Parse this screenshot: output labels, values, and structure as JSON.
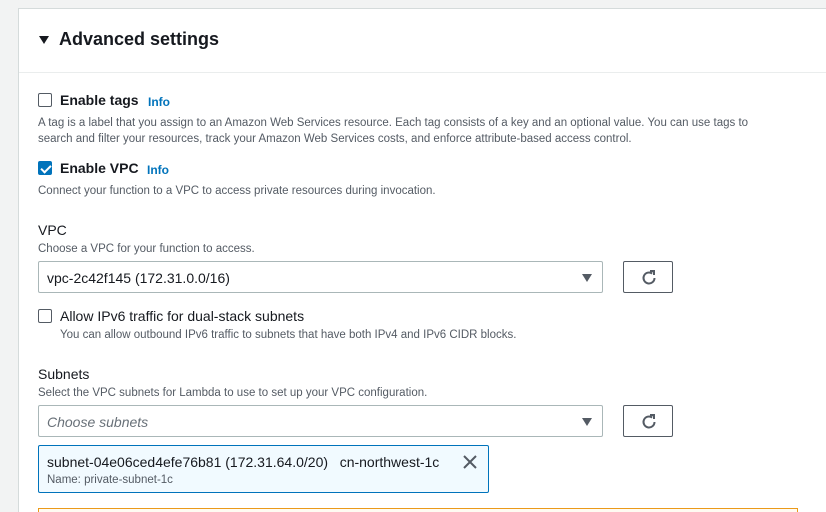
{
  "section": {
    "title": "Advanced settings"
  },
  "tags": {
    "label": "Enable tags",
    "info": "Info",
    "checked": false,
    "description_line1": "A tag is a label that you assign to an Amazon Web Services resource. Each tag consists of a key and an optional value. You can use tags to",
    "description_line2": "search and filter your resources, track your Amazon Web Services costs, and enforce attribute-based access control."
  },
  "vpc_toggle": {
    "label": "Enable VPC",
    "info": "Info",
    "checked": true,
    "description": "Connect your function to a VPC to access private resources during invocation."
  },
  "vpc": {
    "label": "VPC",
    "description": "Choose a VPC for your function to access.",
    "selected": "vpc-2c42f145 (172.31.0.0/16)"
  },
  "ipv6": {
    "label": "Allow IPv6 traffic for dual-stack subnets",
    "checked": false,
    "description": "You can allow outbound IPv6 traffic to subnets that have both IPv4 and IPv6 CIDR blocks."
  },
  "subnets": {
    "label": "Subnets",
    "description": "Select the VPC subnets for Lambda to use to set up your VPC configuration.",
    "placeholder": "Choose subnets",
    "tokens": [
      {
        "id": "subnet-04e06ced4efe76b81 (172.31.64.0/20)",
        "zone": "cn-northwest-1c",
        "name": "Name: private-subnet-1c"
      }
    ]
  },
  "colors": {
    "accent": "#0073bb",
    "border": "#aab7b8",
    "warning": "#eb9a1a"
  }
}
